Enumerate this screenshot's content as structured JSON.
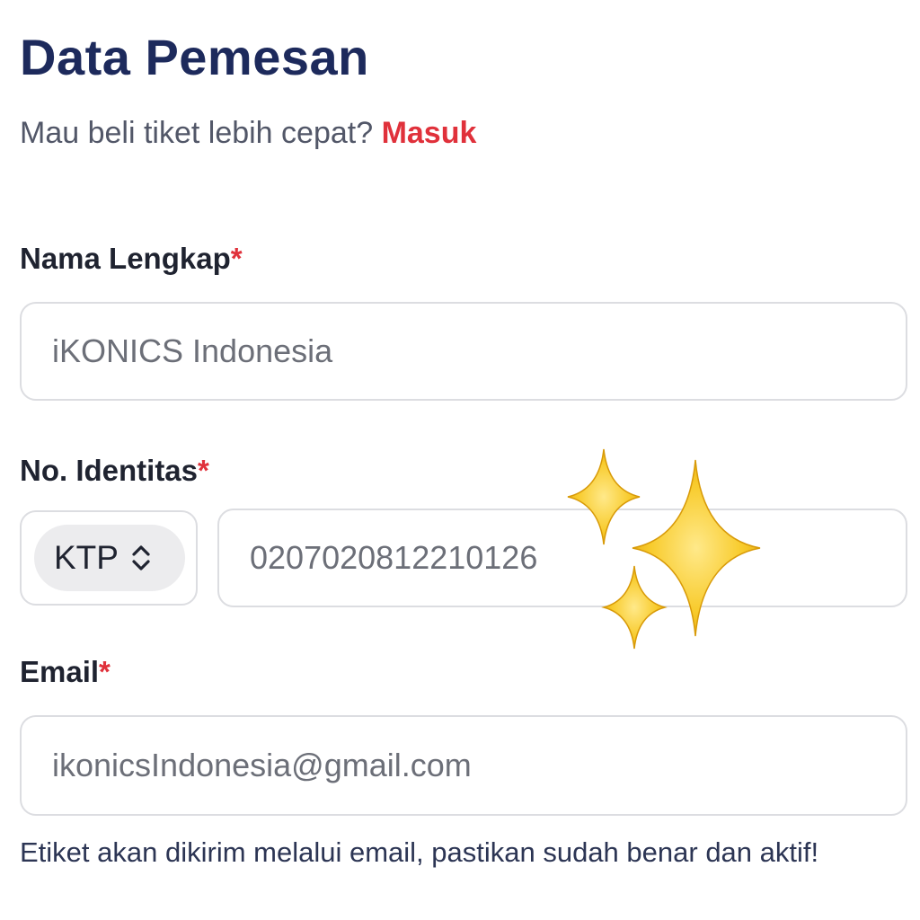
{
  "form": {
    "title": "Data Pemesan",
    "login_prompt": "Mau beli tiket lebih cepat?",
    "login_link": "Masuk"
  },
  "fields": {
    "full_name": {
      "label": "Nama Lengkap",
      "required_mark": "*",
      "value": "iKONICS Indonesia"
    },
    "identity": {
      "label": "No. Identitas",
      "required_mark": "*",
      "type_selected": "KTP",
      "value": "0207020812210126"
    },
    "email": {
      "label": "Email",
      "required_mark": "*",
      "value": "ikonicsIndonesia@gmail.com",
      "helper": "Etiket akan dikirim melalui email, pastikan sudah benar dan aktif!"
    }
  },
  "colors": {
    "title": "#1d2a5c",
    "accent_red": "#e0313b",
    "border": "#dcdde1",
    "sparkle": "#f6c21a"
  },
  "decorations": {
    "sparkle_icon": "sparkles-emoji"
  }
}
